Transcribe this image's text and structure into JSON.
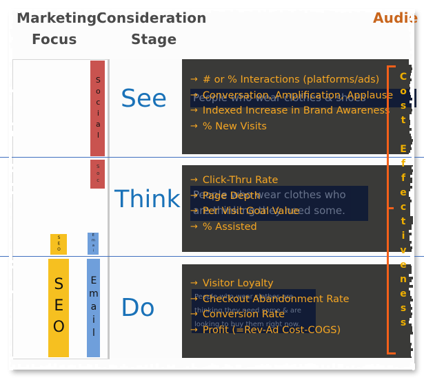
{
  "headers": {
    "marketing": "Marketing",
    "focus": "Focus",
    "consideration": "Consideration",
    "stage": "Stage",
    "audience": "Audie"
  },
  "colors": {
    "stage_blue": "#1a72b8",
    "metric_orange": "#f5a623",
    "bracket_orange": "#f4601a",
    "social_red": "#c9534f",
    "seo_gold": "#f6c020",
    "email_blue": "#6f9fdb",
    "panel_dark": "#3a3a38",
    "ghost_highlight": "#101b36",
    "heading_gray": "#4a4a4a",
    "divider_blue": "#3f6fbf"
  },
  "stages": [
    {
      "label": "See",
      "channels": [
        {
          "name": "Social",
          "color": "#c9534f"
        }
      ],
      "metrics": [
        "# or % Interactions (platforms/ads)",
        "Conversation, Amplification, Applause",
        "Indexed Increase in Brand Awareness",
        "% New Visits"
      ],
      "audience_note": "People who wear clothes & shoes"
    },
    {
      "label": "Think",
      "channels": [
        {
          "name": "Social",
          "color": "#c9534f"
        },
        {
          "name": "SEO",
          "color": "#f6c020"
        },
        {
          "name": "Email",
          "color": "#6f9fdb"
        }
      ],
      "metrics": [
        "Click-Thru Rate",
        "Page Depth",
        "Per Visit Goal Value",
        "% Assisted"
      ],
      "audience_note": "People who wear clothes who are thinking they need some."
    },
    {
      "label": "Do",
      "channels": [
        {
          "name": "SEO",
          "color": "#f6c020"
        },
        {
          "name": "Email",
          "color": "#6f9fdb"
        }
      ],
      "metrics": [
        "Visitor Loyalty",
        "Checkout Abandonment Rate",
        "Conversion Rate",
        "Profit (=Rev-Ad Cost-COGS)"
      ],
      "audience_note": "People who wear clothes are thinking they need some & are looking to buy them right now."
    }
  ],
  "bars": {
    "social_label": "Social",
    "social_stub_label": "Soc",
    "seo_label": "SEO",
    "seo_stub_label": "SEO",
    "email_label": "Email",
    "email_stub_label": "Emai"
  },
  "right_bracket": {
    "label": "Cost Effectiveness"
  },
  "arrow_glyph": "→"
}
